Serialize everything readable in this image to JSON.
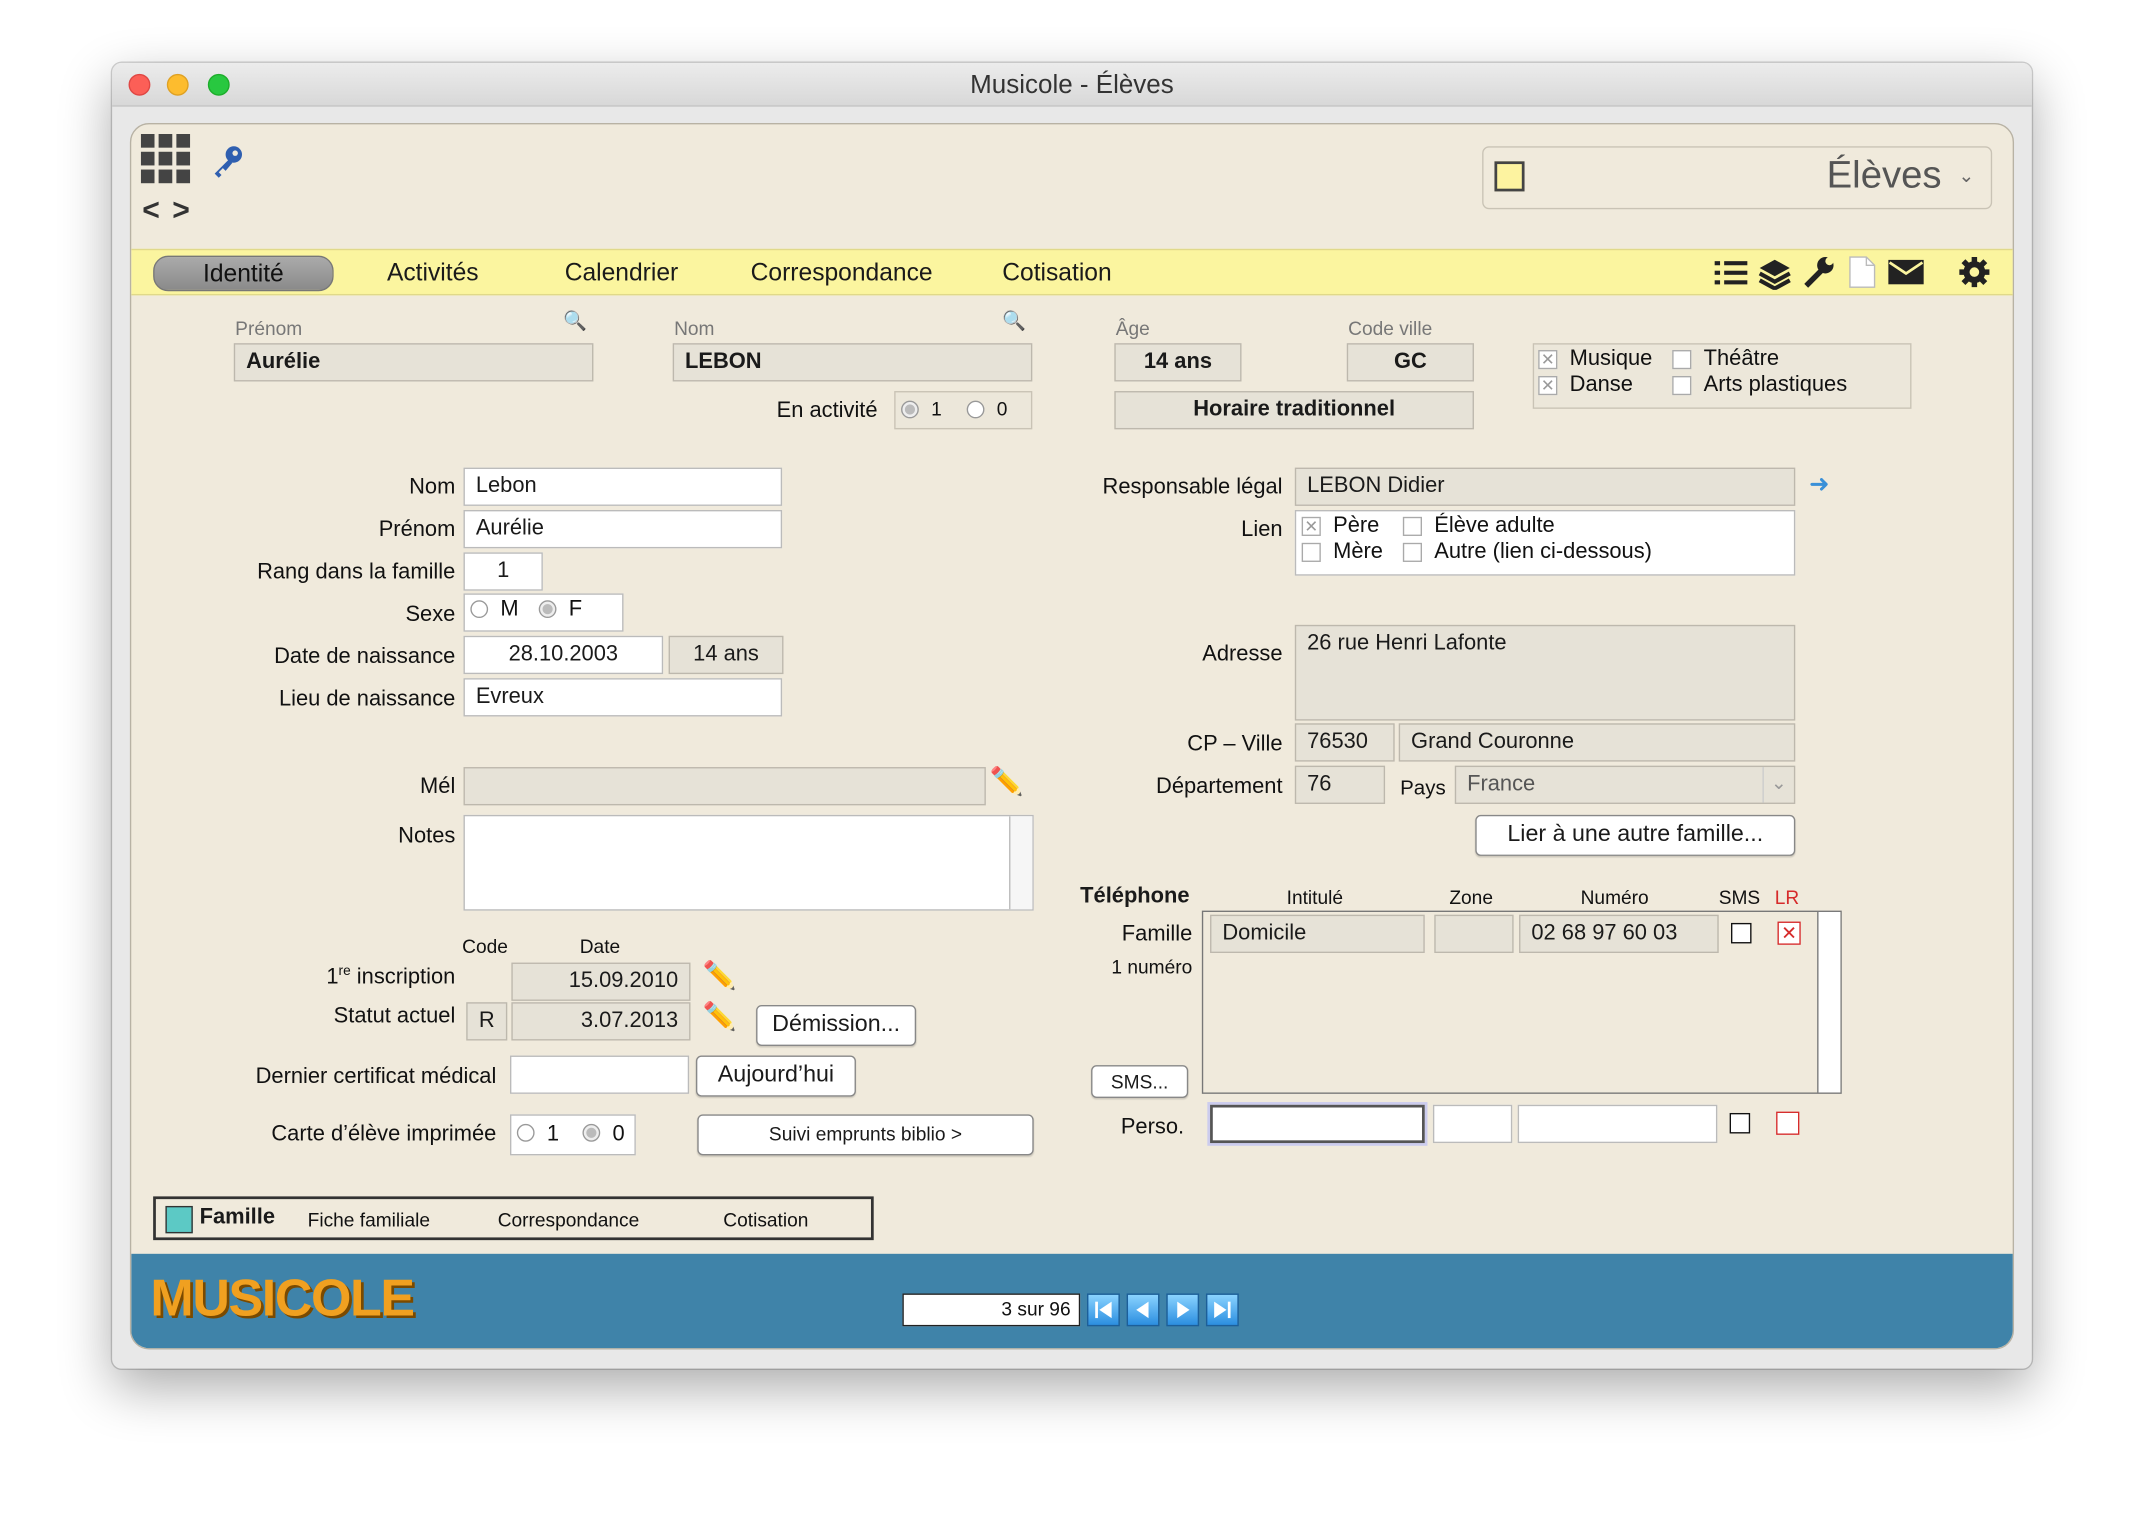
{
  "window": {
    "title": "Musicole - Élèves"
  },
  "top": {
    "module": "Élèves",
    "nav_prev": "<",
    "nav_next": ">"
  },
  "tabs": [
    "Identité",
    "Activités",
    "Calendrier",
    "Correspondance",
    "Cotisation"
  ],
  "header": {
    "prenom_label": "Prénom",
    "prenom": "Aurélie",
    "nom_label": "Nom",
    "nom": "LEBON",
    "age_label": "Âge",
    "age": "14 ans",
    "code_ville_label": "Code ville",
    "code_ville": "GC",
    "horaire": "Horaire traditionnel",
    "en_activite_label": "En activité",
    "opt_1": "1",
    "opt_0": "0",
    "disciplines": [
      "Musique",
      "Danse",
      "Théâtre",
      "Arts plastiques"
    ]
  },
  "identity": {
    "nom_label": "Nom",
    "nom": "Lebon",
    "prenom_label": "Prénom",
    "prenom": "Aurélie",
    "rang_label": "Rang dans la famille",
    "rang": "1",
    "sexe_label": "Sexe",
    "sexe_m": "M",
    "sexe_f": "F",
    "dob_label": "Date de naissance",
    "dob": "28.10.2003",
    "dob_age": "14 ans",
    "lieu_label": "Lieu de naissance",
    "lieu": "Evreux",
    "mel_label": "Mél",
    "notes_label": "Notes"
  },
  "registration": {
    "code_label": "Code",
    "date_label": "Date",
    "first_label_1": "1",
    "first_label_sup": "re",
    "first_label_2": " inscription",
    "first_date": "15.09.2010",
    "statut_label": "Statut actuel",
    "statut_code": "R",
    "statut_date": "3.07.2013",
    "demission": "Démission...",
    "certif_label": "Dernier certificat médical",
    "aujourdhui": "Aujourd’hui",
    "carte_label": "Carte d’élève imprimée",
    "carte_1": "1",
    "carte_0": "0",
    "suivi": "Suivi emprunts biblio >"
  },
  "guardian": {
    "resp_label": "Responsable légal",
    "resp": "LEBON Didier",
    "lien_label": "Lien",
    "lien_opts": [
      "Père",
      "Mère",
      "Élève adulte",
      "Autre (lien ci-dessous)"
    ],
    "adresse_label": "Adresse",
    "adresse": "26 rue Henri Lafonte",
    "cp_label": "CP – Ville",
    "cp": "76530",
    "ville": "Grand Couronne",
    "dept_label": "Département",
    "dept": "76",
    "pays_label": "Pays",
    "pays": "France",
    "lier": "Lier à une autre famille..."
  },
  "phone": {
    "title": "Téléphone",
    "col_intitule": "Intitulé",
    "col_zone": "Zone",
    "col_numero": "Numéro",
    "col_sms": "SMS",
    "col_lr": "LR",
    "famille_label": "Famille",
    "count": "1 numéro",
    "row_intitule": "Domicile",
    "row_zone": "",
    "row_numero": "02 68 97 60 03",
    "sms_btn": "SMS...",
    "perso_label": "Perso."
  },
  "bottom_tabs": {
    "famille": "Famille",
    "fiche": "Fiche familiale",
    "corresp": "Correspondance",
    "cotis": "Cotisation"
  },
  "footer": {
    "logo": "MUSICOLE",
    "record": "3 sur 96"
  },
  "colors": {
    "tab_bar": "#fbf59f",
    "panel": "#f0eadc",
    "footer": "#3f83a9",
    "lr_red": "#d62b2b",
    "logo_orange": "#f0a020"
  }
}
